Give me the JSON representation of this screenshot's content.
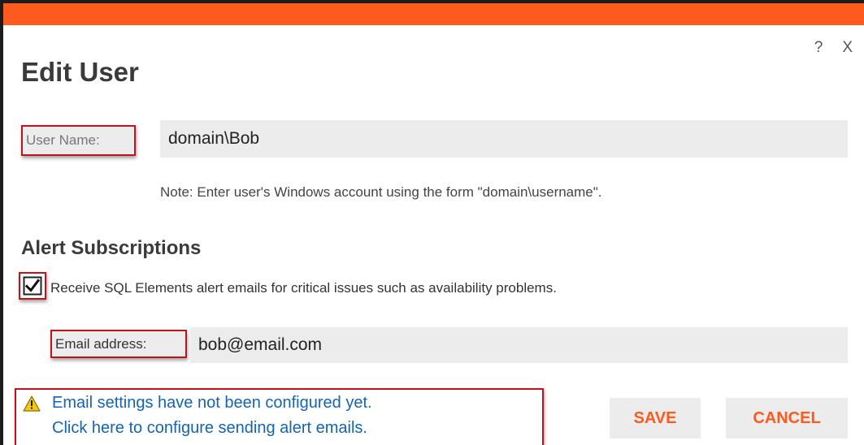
{
  "dialog": {
    "title": "Edit User",
    "help_label": "?",
    "close_label": "X",
    "accent_color": "#fd5a1e"
  },
  "user_name": {
    "label": "User Name:",
    "value": "domain\\Bob",
    "note": "Note: Enter user's Windows account using the form \"domain\\username\"."
  },
  "alerts": {
    "section_title": "Alert Subscriptions",
    "checkbox_checked": true,
    "checkbox_label": "Receive SQL Elements alert emails for critical issues such as availability problems.",
    "email_label": "Email address:",
    "email_value": "bob@email.com"
  },
  "warning": {
    "line1": "Email settings have not been configured yet.",
    "line2": "Click here to configure sending alert emails."
  },
  "buttons": {
    "save_label": "SAVE",
    "cancel_label": "CANCEL"
  }
}
